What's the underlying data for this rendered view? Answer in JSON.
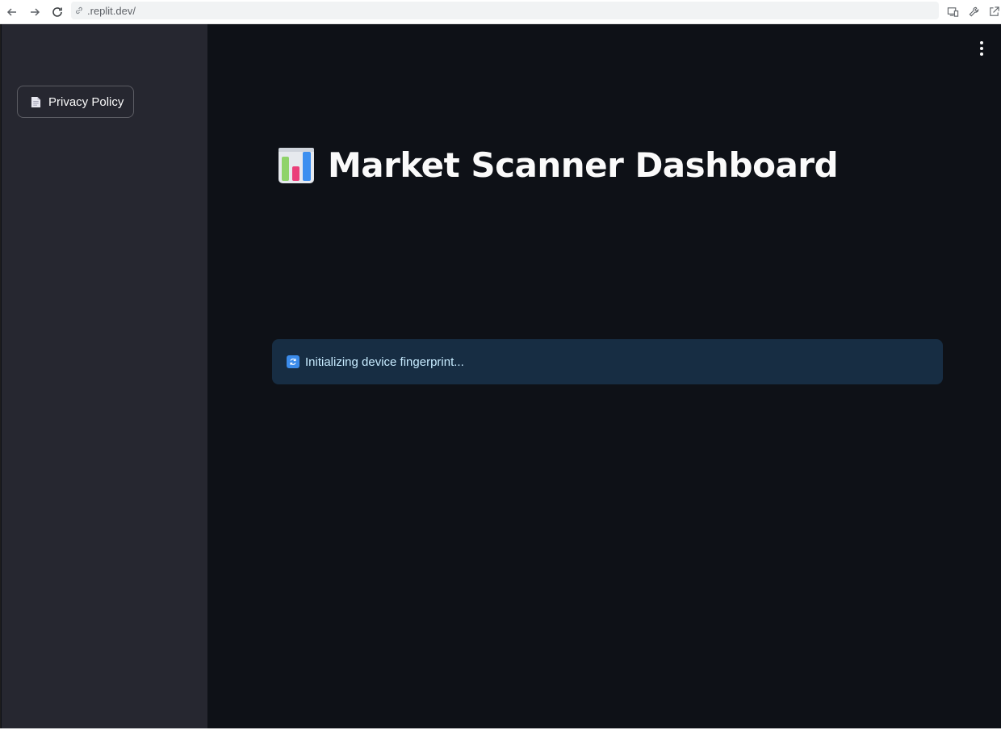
{
  "browser": {
    "url": ".replit.dev/"
  },
  "sidebar": {
    "privacy_button": {
      "label": "Privacy Policy",
      "icon": "document-icon"
    }
  },
  "main": {
    "title": "Market Scanner Dashboard",
    "title_icon": "bar-chart-icon",
    "info_message": "Initializing device fingerprint...",
    "info_icon": "refresh-icon"
  },
  "colors": {
    "background": "#0e1117",
    "sidebar": "#262730",
    "info_bg": "#172d43",
    "info_text": "#c7ebff"
  }
}
